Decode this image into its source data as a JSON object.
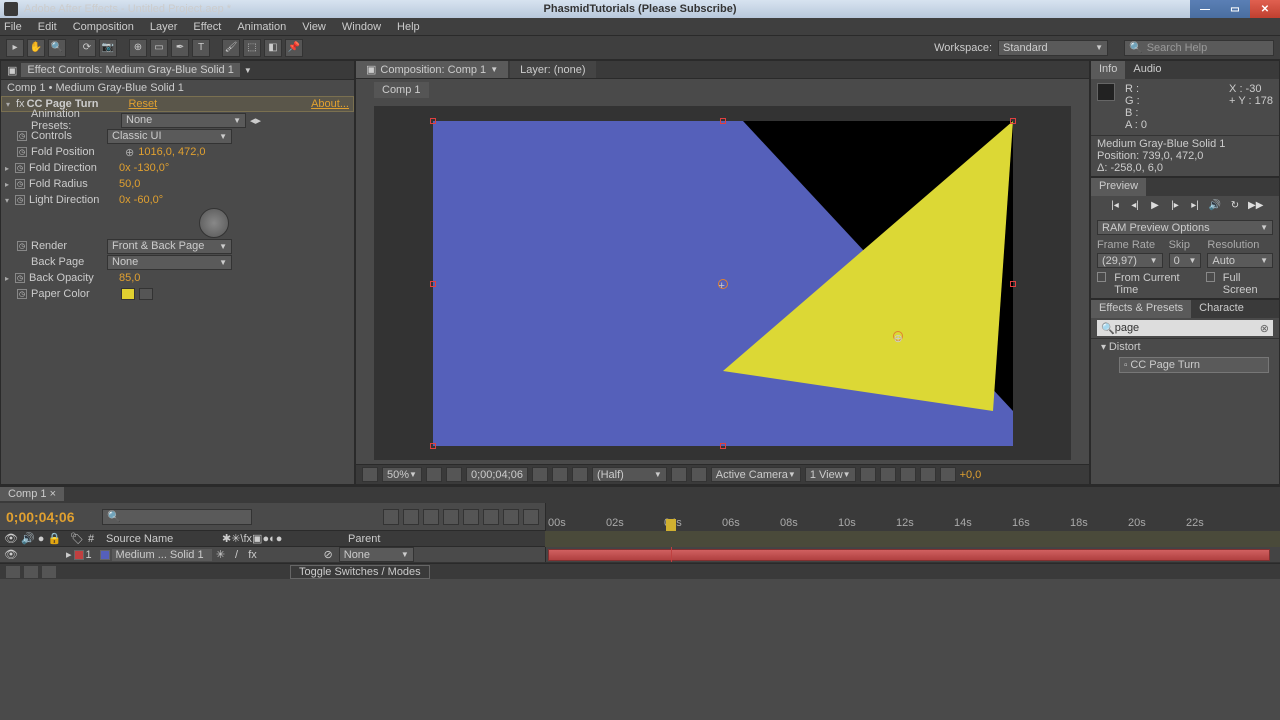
{
  "title": "Adobe After Effects - Untitled Project.aep *",
  "subtitle": "PhasmidTutorials (Please Subscribe)",
  "menu": [
    "File",
    "Edit",
    "Composition",
    "Layer",
    "Effect",
    "Animation",
    "View",
    "Window",
    "Help"
  ],
  "workspace": {
    "label": "Workspace:",
    "value": "Standard"
  },
  "search_help_ph": "Search Help",
  "effect_controls": {
    "tab": "Effect Controls: Medium Gray-Blue Solid 1",
    "crumb": "Comp 1 • Medium Gray-Blue Solid 1",
    "fx_name": "CC Page Turn",
    "reset": "Reset",
    "about": "About...",
    "anim_presets_label": "Animation Presets:",
    "anim_presets_val": "None",
    "controls_label": "Controls",
    "controls_val": "Classic UI",
    "fold_pos_label": "Fold Position",
    "fold_pos_val": "1016,0, 472,0",
    "fold_dir_label": "Fold Direction",
    "fold_dir_val": "0x -130,0°",
    "fold_rad_label": "Fold Radius",
    "fold_rad_val": "50,0",
    "light_dir_label": "Light Direction",
    "light_dir_val": "0x -60,0°",
    "render_label": "Render",
    "render_val": "Front & Back Page",
    "back_page_label": "Back Page",
    "back_page_val": "None",
    "back_opacity_label": "Back Opacity",
    "back_opacity_val": "85,0",
    "paper_color_label": "Paper Color"
  },
  "comp": {
    "tab1": "Composition: Comp 1",
    "tab2": "Layer: (none)",
    "mini": "Comp 1",
    "zoom": "50%",
    "time": "0;00;04;06",
    "res": "(Half)",
    "camera": "Active Camera",
    "views": "1 View",
    "exp": "+0,0"
  },
  "info": {
    "tab1": "Info",
    "tab2": "Audio",
    "r": "R :",
    "g": "G :",
    "b": "B :",
    "a": "A : 0",
    "x": "X : -30",
    "y": "Y : 178",
    "layer": "Medium Gray-Blue Solid 1",
    "pos": "Position: 739,0, 472,0",
    "delta": "Δ: -258,0, 6,0"
  },
  "preview": {
    "tab": "Preview",
    "ram_dd": "RAM Preview Options",
    "fr_label": "Frame Rate",
    "skip_label": "Skip",
    "res_label": "Resolution",
    "fr_val": "(29,97)",
    "skip_val": "0",
    "res_val": "Auto",
    "from_current": "From Current Time",
    "full_screen": "Full Screen"
  },
  "effects_presets": {
    "tab1": "Effects & Presets",
    "tab2": "Characte",
    "search": "page",
    "category": "Distort",
    "item": "CC Page Turn"
  },
  "timeline": {
    "tab": "Comp 1",
    "timecode": "0;00;04;06",
    "col_num": "#",
    "col_src": "Source Name",
    "col_parent": "Parent",
    "layer_num": "1",
    "layer_name": "Medium ... Solid 1",
    "parent_val": "None",
    "ticks": [
      "00s",
      "02s",
      "04s",
      "06s",
      "08s",
      "10s",
      "12s",
      "14s",
      "16s",
      "18s",
      "20s",
      "22s"
    ],
    "toggle": "Toggle Switches / Modes"
  }
}
